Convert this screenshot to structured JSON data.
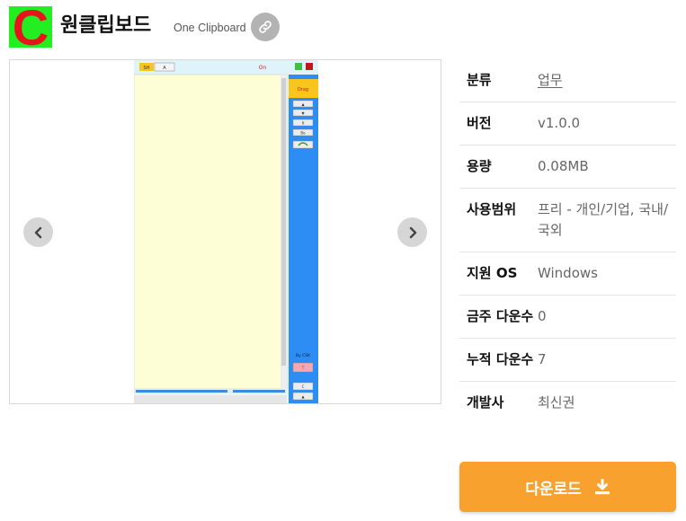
{
  "logo": {
    "letter": "C",
    "bg_color": "#22ee22",
    "letter_color": "#e8141c"
  },
  "header": {
    "title": "원클립보드",
    "subtitle": "One Clipboard",
    "link_icon": "link-icon"
  },
  "carousel": {
    "prev_icon": "chevron-left-icon",
    "next_icon": "chevron-right-icon",
    "screenshot": {
      "top_buttons": [
        "SH",
        "A"
      ],
      "status": "On",
      "drag_label": "Drag",
      "side_buttons": [
        "▲",
        "▼",
        "It",
        "Bo"
      ],
      "by_label": "By CSK",
      "bottom_buttons": [
        "T",
        "C",
        "▲"
      ]
    }
  },
  "info": {
    "rows": [
      {
        "key": "분류",
        "value": "업무"
      },
      {
        "key": "버전",
        "value": "v1.0.0"
      },
      {
        "key": "용량",
        "value": "0.08MB"
      },
      {
        "key": "사용범위",
        "value": "프리 - 개인/기업, 국내/국외"
      },
      {
        "key": "지원 OS",
        "value": "Windows"
      },
      {
        "key": "금주 다운수",
        "value": "0"
      },
      {
        "key": "누적 다운수",
        "value": "7"
      },
      {
        "key": "개발사",
        "value": "최신권"
      }
    ]
  },
  "download": {
    "label": "다운로드",
    "icon": "download-icon",
    "color": "#f8a12f"
  }
}
